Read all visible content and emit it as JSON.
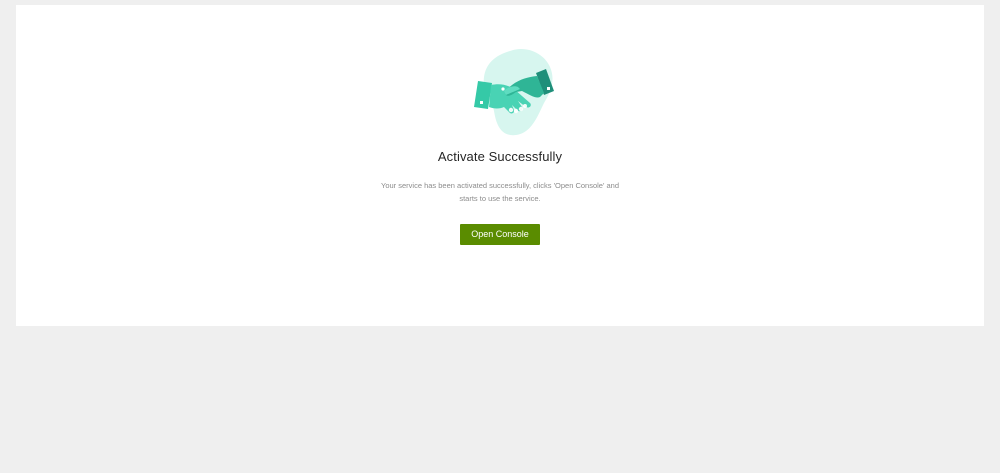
{
  "result": {
    "illustration_icon": "handshake-icon",
    "title": "Activate Successfully",
    "description_line1": "Your service has been activated successfully, clicks 'Open Console' and",
    "description_line2": "starts to use the service.",
    "open_console_label": "Open Console"
  },
  "colors": {
    "page_background": "#efefef",
    "card_background": "#ffffff",
    "primary_button": "#5a8c00",
    "illustration_blob": "#d7f6ef",
    "illustration_hand_light": "#49d3b4",
    "illustration_hand_dark": "#1f8f7a"
  }
}
